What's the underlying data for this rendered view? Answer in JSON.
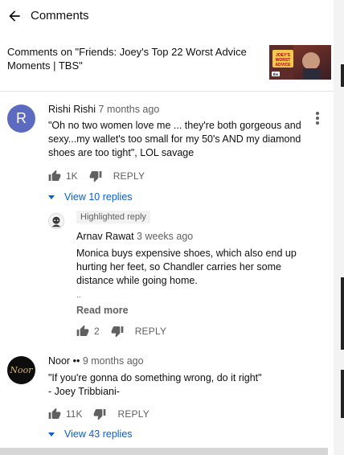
{
  "header": {
    "title": "Comments"
  },
  "video": {
    "context": "Comments on \"Friends: Joey's Top 22 Worst Advice Moments | TBS\"",
    "thumbnail_text": "JOEY'S WORST ADVICE",
    "thumbnail_badge": "tbs"
  },
  "comments": [
    {
      "avatar_letter": "R",
      "avatar_color": "#5c6bc0",
      "author": "Rishi Rishi",
      "time": "7 months ago",
      "text": "\"Oh no two women love me ... they're both gorgeous and sexy...my wallet's too small for my 50's AND my diamond shoes are too tight\", LOL savage",
      "likes": "1K",
      "reply_label": "REPLY",
      "view_replies": "View 10 replies"
    },
    {
      "badge": "Highlighted reply",
      "author": "Arnav Rawat",
      "time": "3 weeks ago",
      "text": "Monica buys expensive shoes, which also end up hurting her feet, so Chandler carries her some distance while going home.",
      "ellipsis": "..",
      "read_more": "Read more",
      "likes": "2",
      "reply_label": "REPLY"
    },
    {
      "avatar_text": "Noor",
      "author": "Noor ••",
      "time": "9 months ago",
      "text_line1": "\"If you're gonna do something wrong, do it right\"",
      "text_line2": "- Joey Tribbiani-",
      "likes": "11K",
      "reply_label": "REPLY",
      "view_replies": "View 43 replies"
    }
  ],
  "colors": {
    "link_blue": "#065fd4",
    "meta_gray": "#606060"
  }
}
